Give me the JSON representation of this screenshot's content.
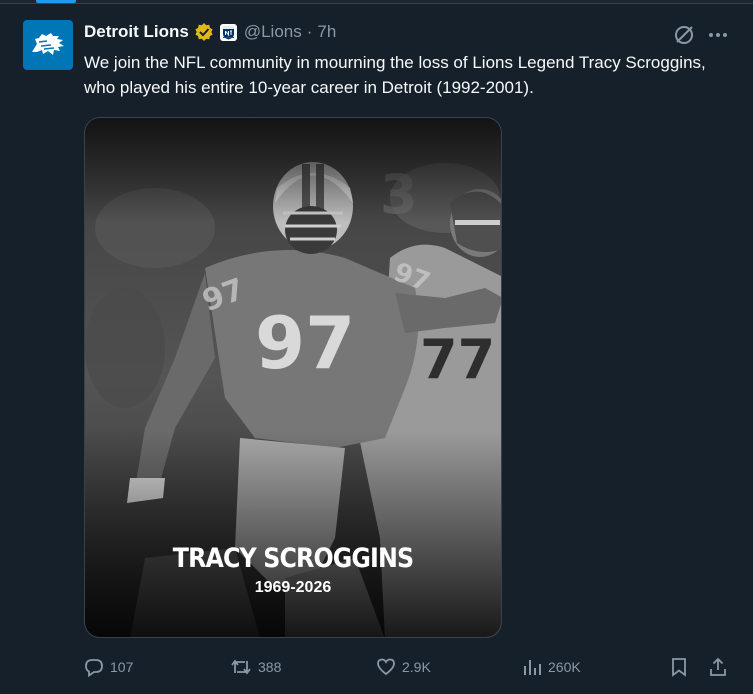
{
  "tweet": {
    "author_name": "Detroit Lions",
    "handle": "@Lions",
    "separator": "·",
    "time": "7h",
    "text": "We join the NFL community in mourning the loss of Lions Legend Tracy Scroggins, who played his entire 10-year career in Detroit (1992-2001).",
    "verified": true,
    "affiliate_badge": "nfl-shield-icon",
    "brand_color": "#0076b6",
    "verified_color": "#e2b719"
  },
  "media": {
    "overlay_name": "TRACY SCROGGINS",
    "overlay_years": "1969-2026",
    "jersey_number": "97",
    "jersey_number_right": "77",
    "background_number": "3"
  },
  "actions": {
    "replies": "107",
    "reposts": "388",
    "likes": "2.9K",
    "views": "260K"
  },
  "icons": [
    "lions-logo-icon",
    "verified-icon",
    "nfl-shield-icon",
    "grok-icon",
    "more-icon",
    "reply-icon",
    "repost-icon",
    "like-icon",
    "views-icon",
    "bookmark-icon",
    "share-icon"
  ]
}
